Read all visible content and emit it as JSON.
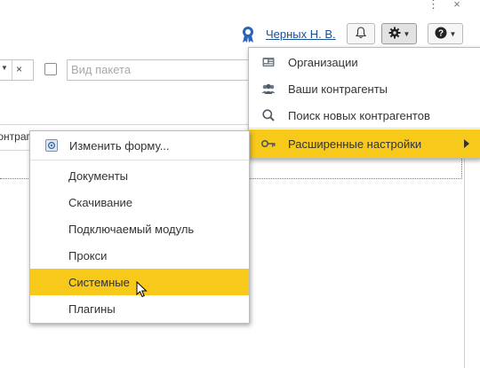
{
  "window": {
    "dots_glyph": "⋮",
    "close_glyph": "×"
  },
  "header": {
    "user_name": "Черных Н. В.",
    "icons": {
      "user": "award-badge-icon",
      "notifications": "bell-icon",
      "settings": "gear-icon",
      "help": "question-circle-icon"
    }
  },
  "filters": {
    "combo_clear_glyph": "×",
    "package_placeholder": "Вид пакета",
    "table_header_fragment": "контраг"
  },
  "main_menu": {
    "items": [
      {
        "label": "Организации",
        "icon": "organization-card-icon"
      },
      {
        "label": "Ваши контрагенты",
        "icon": "people-group-icon"
      },
      {
        "label": "Поиск новых контрагентов",
        "icon": "search-icon"
      },
      {
        "label": "Расширенные настройки",
        "icon": "key-icon",
        "highlighted": true,
        "has_submenu": true
      }
    ]
  },
  "sub_menu": {
    "items": [
      {
        "label": "Изменить форму...",
        "icon": "form-settings-icon"
      },
      {
        "label": "Документы"
      },
      {
        "label": "Скачивание"
      },
      {
        "label": "Подключаемый модуль"
      },
      {
        "label": "Прокси"
      },
      {
        "label": "Системные",
        "highlighted": true
      },
      {
        "label": "Плагины"
      }
    ]
  },
  "colors": {
    "highlight": "#f6c91b",
    "link": "#1c4f8f"
  }
}
